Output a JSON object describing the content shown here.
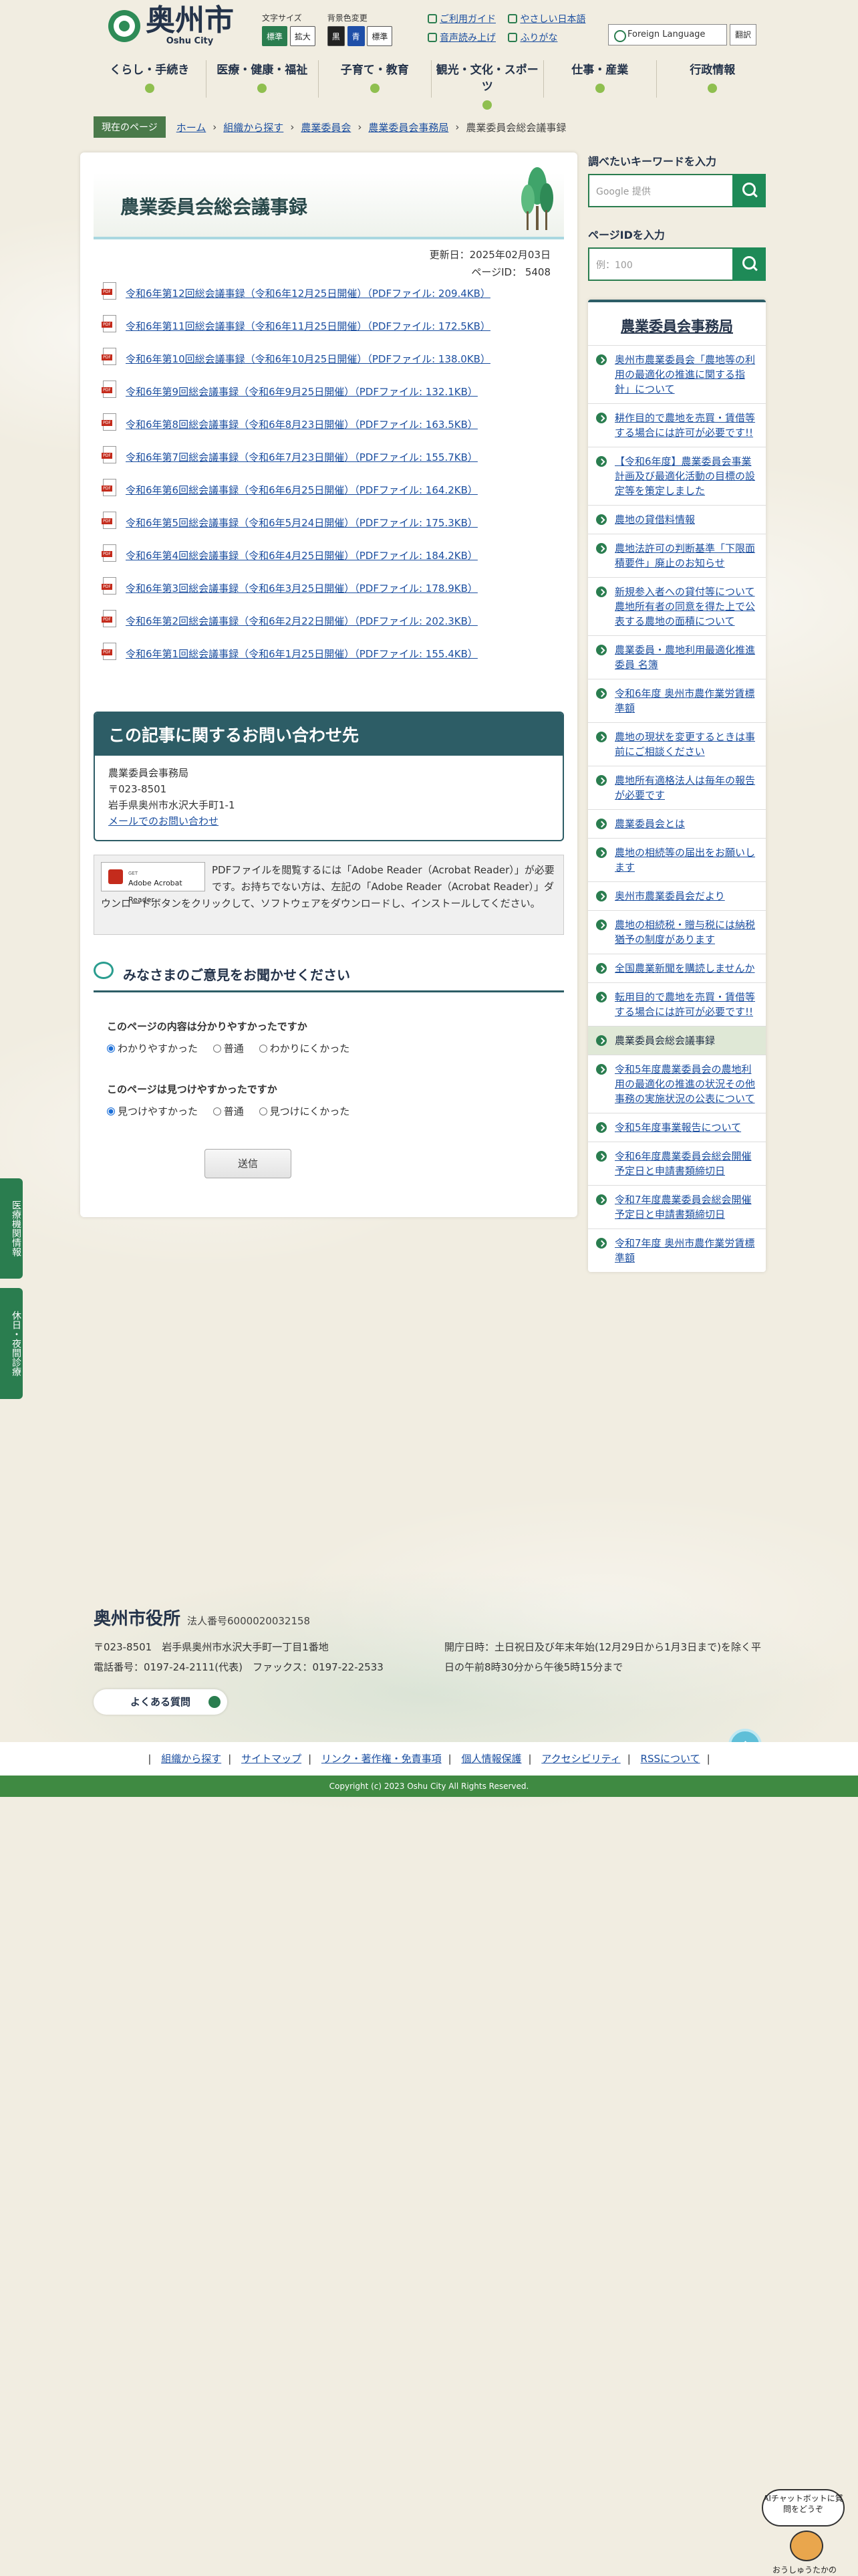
{
  "header": {
    "logo_title": "奥州市",
    "logo_sub": "Oshu City",
    "font_size_label": "文字サイズ",
    "font_standard": "標準",
    "font_large": "拡大",
    "color_label": "背景色変更",
    "color_black": "黒",
    "color_blue": "青",
    "color_standard": "標準",
    "link_guide": "ご利用ガイド",
    "link_easy_jp": "やさしい日本語",
    "link_read_aloud": "音声読み上げ",
    "link_furigana": "ふりがな",
    "lang_select": "Foreign Language",
    "lang_button": "翻訳"
  },
  "gnav": [
    "くらし・手続き",
    "医療・健康・福祉",
    "子育て・教育",
    "観光・文化・スポーツ",
    "仕事・産業",
    "行政情報"
  ],
  "breadcrumb": {
    "here_label": "現在のページ",
    "items": [
      "ホーム",
      "組織から探す",
      "農業委員会",
      "農業委員会事務局"
    ],
    "current": "農業委員会総会議事録"
  },
  "page": {
    "title": "農業委員会総会議事録",
    "updated": "更新日：2025年02月03日",
    "page_id": "ページID： 5408"
  },
  "documents": [
    "令和6年第12回総会議事録（令和6年12月25日開催）（PDFファイル: 209.4KB）",
    "令和6年第11回総会議事録（令和6年11月25日開催）（PDFファイル: 172.5KB）",
    "令和6年第10回総会議事録（令和6年10月25日開催）（PDFファイル: 138.0KB）",
    "令和6年第9回総会議事録（令和6年9月25日開催）（PDFファイル: 132.1KB）",
    "令和6年第8回総会議事録（令和6年8月23日開催）（PDFファイル: 163.5KB）",
    "令和6年第7回総会議事録（令和6年7月23日開催）（PDFファイル: 155.7KB）",
    "令和6年第6回総会議事録（令和6年6月25日開催）（PDFファイル: 164.2KB）",
    "令和6年第5回総会議事録（令和6年5月24日開催）（PDFファイル: 175.3KB）",
    "令和6年第4回総会議事録（令和6年4月25日開催）（PDFファイル: 184.2KB）",
    "令和6年第3回総会議事録（令和6年3月25日開催）（PDFファイル: 178.9KB）",
    "令和6年第2回総会議事録（令和6年2月22日開催）（PDFファイル: 202.3KB）",
    "令和6年第1回総会議事録（令和6年1月25日開催）（PDFファイル: 155.4KB）"
  ],
  "pdf_tag": "PDF",
  "contact": {
    "heading": "この記事に関するお問い合わせ先",
    "dept": "農業委員会事務局",
    "postal": "〒023-8501",
    "address": "岩手県奥州市水沢大手町1-1",
    "mail_link": "メールでのお問い合わせ"
  },
  "adobe": {
    "badge_small": "GET",
    "badge_label": "Adobe Acrobat Reader",
    "text": "PDFファイルを閲覧するには「Adobe Reader（Acrobat Reader）」が必要です。お持ちでない方は、左記の「Adobe Reader（Acrobat Reader）」ダウンロードボタンをクリックして、ソフトウェアをダウンロードし、インストールしてください。"
  },
  "survey": {
    "heading": "みなさまのご意見をお聞かせください",
    "q1": "このページの内容は分かりやすかったですか",
    "q1_options": [
      "わかりやすかった",
      "普通",
      "わかりにくかった"
    ],
    "q2": "このページは見つけやすかったですか",
    "q2_options": [
      "見つけやすかった",
      "普通",
      "見つけにくかった"
    ],
    "submit": "送信"
  },
  "sidebar": {
    "keyword_label": "調べたいキーワードを入力",
    "keyword_placeholder": "Google 提供",
    "pageid_label": "ページIDを入力",
    "pageid_placeholder": "例：100",
    "menu_title": "農業委員会事務局",
    "items": [
      "奥州市農業委員会「農地等の利用の最適化の推進に関する指針」について",
      "耕作目的で農地を売買・賃借等する場合には許可が必要です!!",
      "【令和6年度】農業委員会事業計画及び最適化活動の目標の設定等を策定しました",
      "農地の貸借料情報",
      "農地法許可の判断基準「下限面積要件」廃止のお知らせ",
      "新規参入者への貸付等について農地所有者の同意を得た上で公表する農地の面積について",
      "農業委員・農地利用最適化推進委員 名簿",
      "令和6年度 奥州市農作業労賃標準額",
      "農地の現状を変更するときは事前にご相談ください",
      "農地所有適格法人は毎年の報告が必要です",
      "農業委員会とは",
      "農地の相続等の届出をお願いします",
      "奥州市農業委員会だより",
      "農地の相続税・贈与税には納税猶予の制度があります",
      "全国農業新聞を購読しませんか",
      "転用目的で農地を売買・賃借等する場合には許可が必要です!!",
      "農業委員会総会議事録",
      "令和5年度農業委員会の農地利用の最適化の推進の状況その他事務の実施状況の公表について",
      "令和5年度事業報告について",
      "令和6年度農業委員会総会開催予定日と申請書類締切日",
      "令和7年度農業委員会総会開催予定日と申請書類締切日",
      "令和7年度 奥州市農作業労賃標準額"
    ],
    "current_index": 16
  },
  "float_tabs": [
    "医療機関情報",
    "休日・夜間診療"
  ],
  "footer": {
    "name": "奥州市役所",
    "corp_no": "法人番号6000020032158",
    "address": "〒023-8501　岩手県奥州市水沢大手町一丁目1番地",
    "phone": "電話番号：0197-24-2111(代表)　ファックス：0197-22-2533",
    "hours": "開庁日時：土日祝日及び年末年始(12月29日から1月3日まで)を除く平日の午前8時30分から午後5時15分まで",
    "faq": "よくある質問",
    "links": [
      "組織から探す",
      "サイトマップ",
      "リンク・著作権・免責事項",
      "個人情報保護",
      "アクセシビリティ",
      "RSSについて"
    ],
    "copyright": "Copyright (c) 2023 Oshu City All Rights Reserved."
  },
  "chatbot": {
    "bubble": "AIチャットボットに質問をどうぞ",
    "name": "おうしゅうたかの"
  }
}
